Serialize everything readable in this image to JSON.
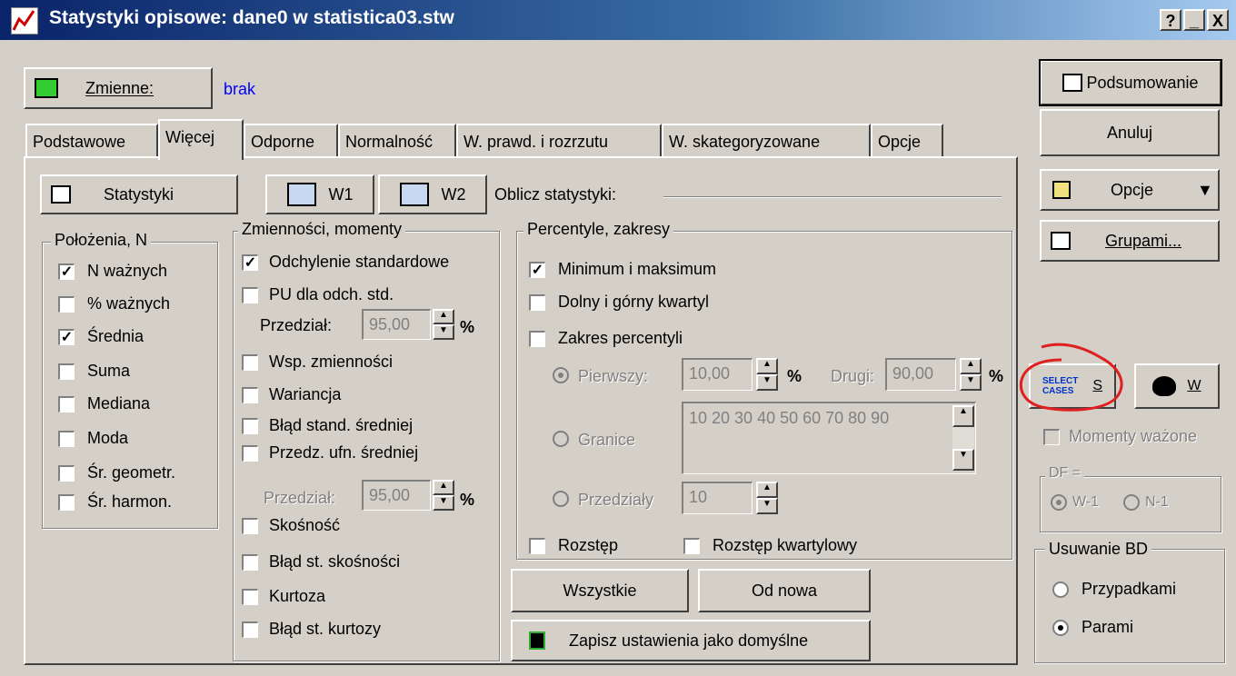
{
  "window": {
    "title": "Statystyki opisowe: dane0 w statistica03.stw",
    "controls": [
      "?",
      "_",
      "X"
    ]
  },
  "variables": {
    "button_label": "Zmienne:",
    "value": "brak"
  },
  "tabs": [
    "Podstawowe",
    "Więcej",
    "Odporne",
    "Normalność",
    "W. prawd. i rozrzutu",
    "W. skategoryzowane",
    "Opcje"
  ],
  "active_tab": "Więcej",
  "toolbar": {
    "statystyki": "Statystyki",
    "w1": "W1",
    "w2": "W2",
    "oblicz_label": "Oblicz statystyki:"
  },
  "polozenia": {
    "legend": "Położenia, N",
    "items": [
      {
        "label": "N ważnych",
        "checked": true
      },
      {
        "label": "% ważnych",
        "checked": false
      },
      {
        "label": "Średnia",
        "checked": true
      },
      {
        "label": "Suma",
        "checked": false
      },
      {
        "label": "Mediana",
        "checked": false
      },
      {
        "label": "Moda",
        "checked": false
      },
      {
        "label": "Śr. geometr.",
        "checked": false
      },
      {
        "label": "Śr. harmon.",
        "checked": false
      }
    ]
  },
  "zmiennosci": {
    "legend": "Zmienności, momenty",
    "odchylenie": {
      "label": "Odchylenie standardowe",
      "checked": true
    },
    "pu": {
      "label": "PU dla odch. std.",
      "checked": false
    },
    "przedzial1": {
      "label": "Przedział:",
      "value": "95,00",
      "unit": "%"
    },
    "wsp": {
      "label": "Wsp. zmienności",
      "checked": false
    },
    "wariancja": {
      "label": "Wariancja",
      "checked": false
    },
    "blad_sred": {
      "label": "Błąd stand. średniej",
      "checked": false
    },
    "przedz_ufn": {
      "label": "Przedz. ufn. średniej",
      "checked": false
    },
    "przedzial2": {
      "label": "Przedział:",
      "value": "95,00",
      "unit": "%"
    },
    "skosnosc": {
      "label": "Skośność",
      "checked": false
    },
    "blad_skos": {
      "label": "Błąd st. skośności",
      "checked": false
    },
    "kurtoza": {
      "label": "Kurtoza",
      "checked": false
    },
    "blad_kurt": {
      "label": "Błąd st. kurtozy",
      "checked": false
    }
  },
  "percentyle": {
    "legend": "Percentyle, zakresy",
    "minmax": {
      "label": "Minimum i maksimum",
      "checked": true
    },
    "kwartyl": {
      "label": "Dolny i górny kwartyl",
      "checked": false
    },
    "zakres": {
      "label": "Zakres percentyli",
      "checked": false
    },
    "pierwszy": {
      "label": "Pierwszy:",
      "value": "10,00",
      "unit": "%"
    },
    "drugi": {
      "label": "Drugi:",
      "value": "90,00",
      "unit": "%"
    },
    "granice": {
      "label": "Granice",
      "value": "10 20 30 40 50 60 70 80 90"
    },
    "przedzialy": {
      "label": "Przedziały",
      "value": "10"
    },
    "rozstep": {
      "label": "Rozstęp",
      "checked": false
    },
    "rozstep_kw": {
      "label": "Rozstęp kwartylowy",
      "checked": false
    }
  },
  "bottom": {
    "wszystkie": "Wszystkie",
    "od_nowa": "Od nowa",
    "zapisz": "Zapisz ustawienia jako domyślne"
  },
  "right": {
    "podsumowanie": "Podsumowanie",
    "anuluj": "Anuluj",
    "opcje": "Opcje",
    "grupami": "Grupami...",
    "select_icon_text": [
      "SELECT",
      "CASES"
    ],
    "select_label": "S",
    "weight_label": "W",
    "momenty": {
      "label": "Momenty ważone",
      "checked": false
    },
    "df": {
      "legend": "DF =",
      "options": [
        "W-1",
        "N-1"
      ],
      "selected": "W-1"
    },
    "usuwanie": {
      "legend": "Usuwanie BD",
      "options": [
        "Przypadkami",
        "Parami"
      ],
      "selected": "Parami"
    }
  },
  "colors": {
    "title_bar": "#0a246a",
    "dialog_bg": "#d4d0c8",
    "value_link": "#0000ff",
    "annotation": "#e02020"
  }
}
